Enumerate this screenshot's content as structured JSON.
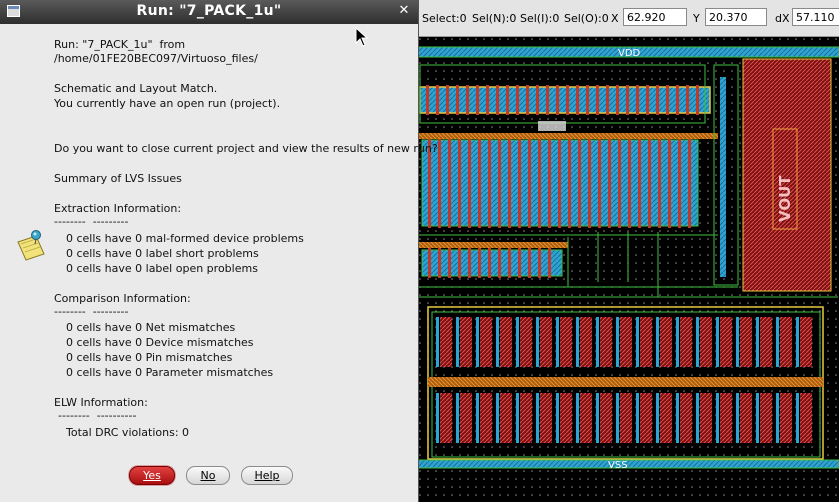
{
  "dialog": {
    "title": "Run: \"7_PACK_1u\"",
    "lines": {
      "run": "Run: \"7_PACK_1u\"  from",
      "path": "/home/01FE20BEC097/Virtuoso_files/",
      "match": "Schematic and Layout Match.",
      "open_run": "You currently have an open run (project).",
      "question": "Do you want to close current project and view the results of new run?",
      "summary": "Summary of LVS Issues",
      "extraction_header": "Extraction Information:",
      "extraction_rule": "--------  ---------",
      "ext1": "0 cells have 0 mal-formed device problems",
      "ext2": "0 cells have 0 label short problems",
      "ext3": "0 cells have 0 label open problems",
      "comparison_header": "Comparison Information:",
      "comparison_rule": "--------  ---------",
      "cmp1": "0 cells have 0 Net mismatches",
      "cmp2": "0 cells have 0 Device mismatches",
      "cmp3": "0 cells have 0 Pin mismatches",
      "cmp4": "0 cells have 0 Parameter mismatches",
      "elw_header": "ELW Information:",
      "elw_rule": "--------  ----------",
      "elw1": "Total DRC violations: 0"
    },
    "buttons": {
      "yes": "Yes",
      "no": "No",
      "help": "Help"
    },
    "close_glyph": "✕"
  },
  "editor": {
    "status": {
      "select": "Select:0",
      "sel_n": "Sel(N):0",
      "sel_i": "Sel(I):0",
      "sel_o": "Sel(O):0",
      "x_label": "X",
      "x_value": "62.920",
      "y_label": "Y",
      "y_value": "20.370",
      "dx_label": "dX",
      "dx_value": "57.110"
    },
    "labels": {
      "vdd": "VDD",
      "vss": "VSS",
      "vout": "VOUT"
    }
  },
  "colors": {
    "yes_button": "#c01818",
    "titlebar": "#3c3c3c",
    "metal_blue": "#2fa8d8",
    "poly_red": "#c0392b",
    "metal_green": "#3fbf3f",
    "yellow": "#e8c840"
  }
}
